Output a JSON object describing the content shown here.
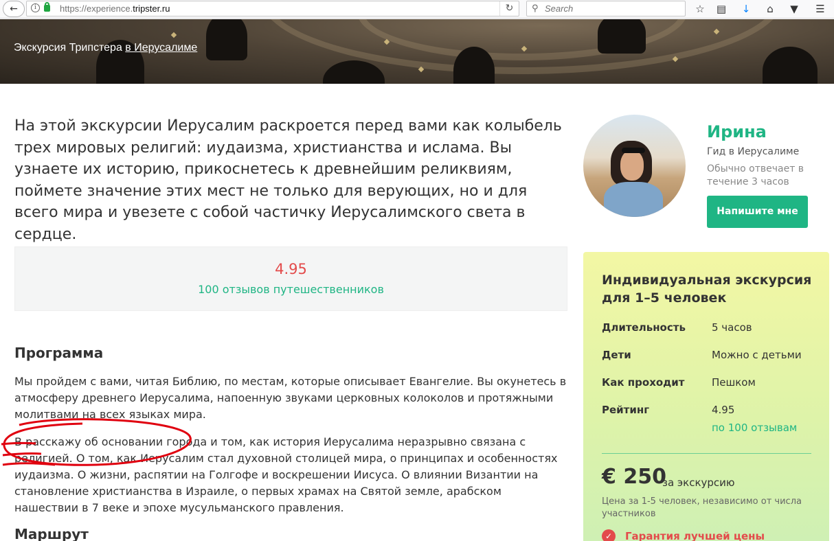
{
  "browser": {
    "url_prefix": "https://experience.",
    "url_domain": "tripster.ru",
    "search_placeholder": "Search"
  },
  "hero": {
    "title_prefix": "Экскурсия Трипстера ",
    "title_link": "в Иерусалиме"
  },
  "intro": "На этой экскурсии Иерусалим раскроется перед вами как колыбель трех мировых религий: иудаизма, христианства и ислама. Вы узнаете их историю, прикоснетесь к древнейшим реликвиям, поймете значение этих мест не только для верующих, но и для всего мира и увезете с собой частичку Иерусалимского света в сердце.",
  "rating": {
    "score": "4.95",
    "reviews": "100 отзывов путешественников"
  },
  "program": {
    "title": "Программа",
    "paragraph1": "Мы пройдем с вами, читая Библию, по местам, которые описывает Евангелие. Вы окунетесь в атмосферу древнего Иерусалима, напоенную звуками церковных колоколов и протяжными молитвами на всех языках мира.",
    "paragraph2": "В расскажу об основании города и том, как история Иерусалима неразрывно связана с религией. О том, как Иерусалим стал духовной столицей мира, о принципах и особенностях иудаизма. О жизни, распятии на Голгофе и воскрешении Иисуса. О влиянии Византии на становление христианства в Израиле, о первых храмах на Святой земле, арабском нашествии в 7 веке и эпохе мусульманского правления."
  },
  "route": {
    "title": "Маршрут"
  },
  "guide": {
    "name": "Ирина",
    "subtitle": "Гид в Иерусалиме",
    "response": "Обычно отвечает в течение 3 часов",
    "button": "Напишите мне"
  },
  "booking": {
    "title": "Индивидуальная экскурсия для 1–5 человек",
    "rows": [
      {
        "label": "Длительность",
        "value": "5 часов"
      },
      {
        "label": "Дети",
        "value": "Можно с детьми"
      },
      {
        "label": "Как проходит",
        "value": "Пешком"
      },
      {
        "label": "Рейтинг",
        "value": "4.95"
      }
    ],
    "rating_link": "по 100 отзывам",
    "price": "€ 250",
    "price_unit": "за экскурсию",
    "price_note": "Цена за 1-5 человек, независимо от числа участников",
    "guarantee": "Гарантия лучшей цены"
  },
  "colors": {
    "accent": "#1fb584",
    "rating": "#e34b4b",
    "scribble": "#e0000f"
  }
}
